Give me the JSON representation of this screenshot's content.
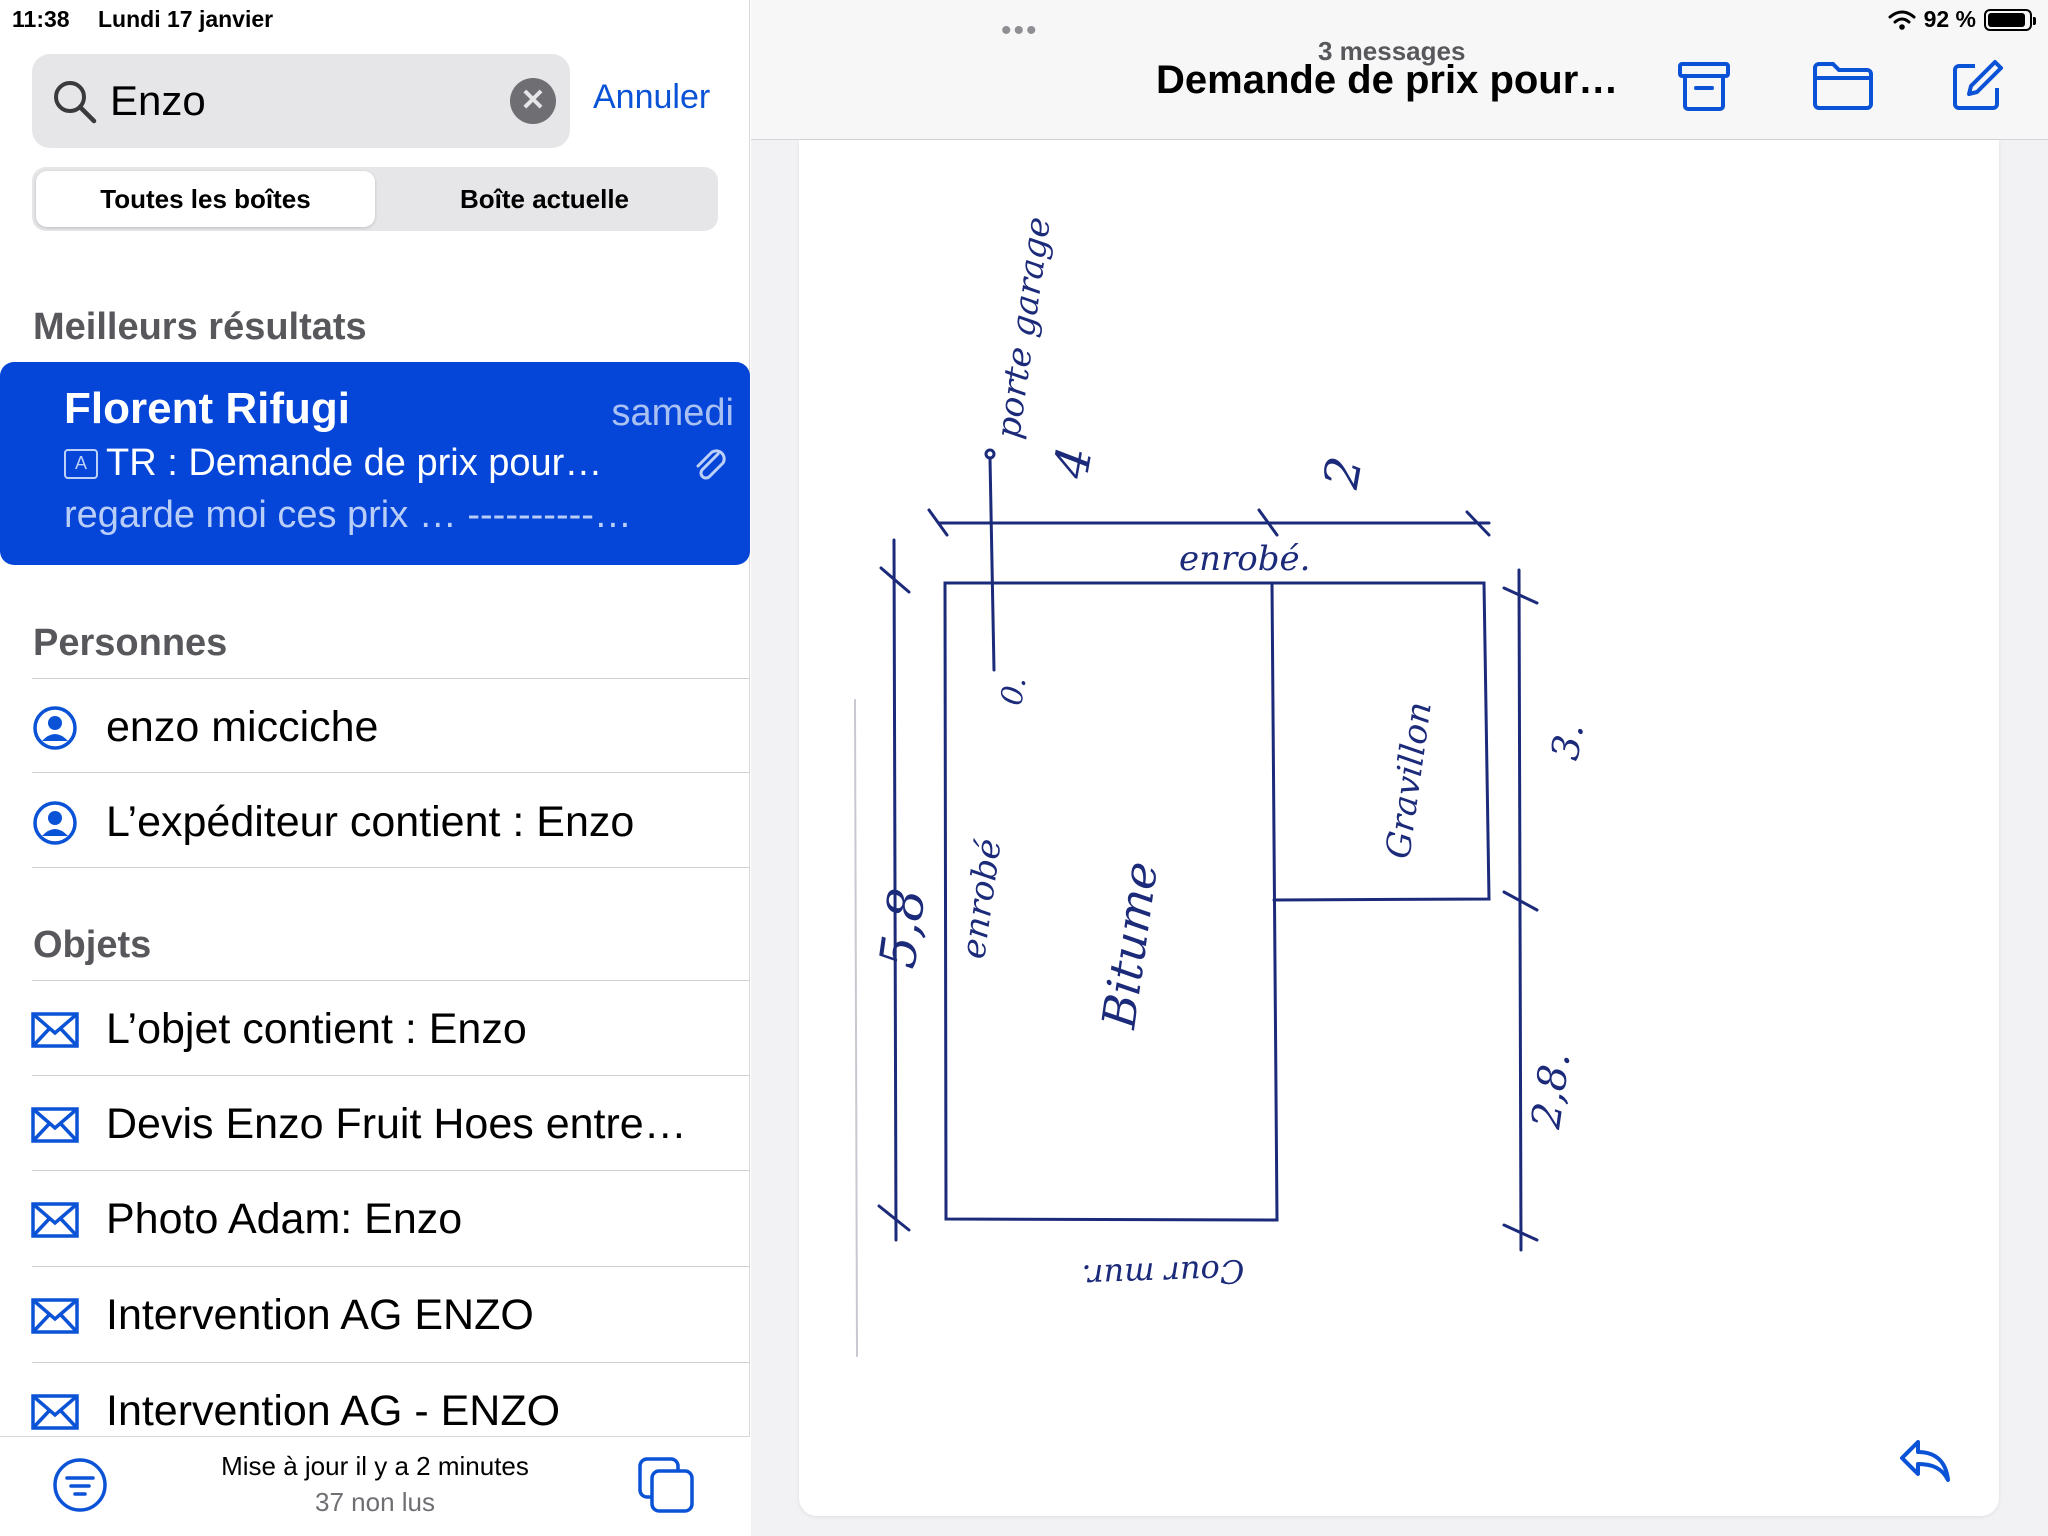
{
  "status": {
    "time": "11:38",
    "date": "Lundi 17 janvier",
    "battery": "92 %",
    "battery_level": 0.92
  },
  "search": {
    "value": "Enzo",
    "cancel_label": "Annuler"
  },
  "segment": {
    "options": [
      "Toutes les boîtes",
      "Boîte actuelle"
    ],
    "selected": 0
  },
  "sections": {
    "best": "Meilleurs résultats",
    "people": "Personnes",
    "subjects": "Objets"
  },
  "best_result": {
    "sender": "Florent Rifugi",
    "date": "samedi",
    "subject": "TR : Demande de prix pour…",
    "preview": "regarde moi ces prix … ----------…"
  },
  "people": [
    {
      "label": "enzo micciche"
    },
    {
      "label": "L’expéditeur contient : Enzo"
    }
  ],
  "subjects": [
    {
      "label": "L’objet contient : Enzo"
    },
    {
      "label": "Devis Enzo Fruit Hoes entre…"
    },
    {
      "label": "Photo Adam: Enzo"
    },
    {
      "label": "Intervention AG ENZO"
    },
    {
      "label": "Intervention AG - ENZO"
    }
  ],
  "bottom": {
    "updated": "Mise à jour il y a 2 minutes",
    "unread": "37 non lus"
  },
  "thread": {
    "count": "3 messages",
    "title": "Demande de prix pour…"
  },
  "sketch": {
    "labels": [
      "porte garage",
      "4",
      "2",
      "enrobé.",
      "0.",
      "Gravillon",
      "3.",
      "5,8",
      "enrobé",
      "Bitume",
      "2,8.",
      "Cour mur."
    ]
  },
  "colors": {
    "accent": "#0a52d6",
    "selected_row": "#0545d8",
    "ink": "#1c2a7a"
  }
}
